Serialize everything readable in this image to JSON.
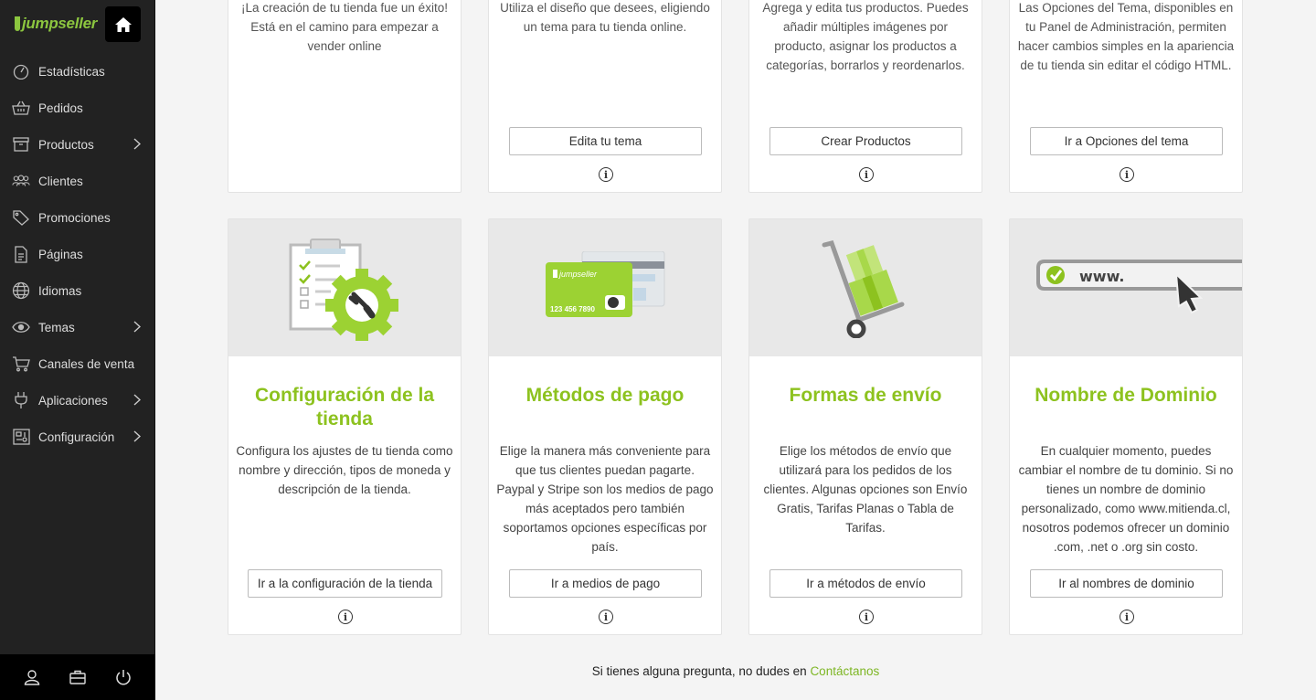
{
  "sidebar": {
    "logo_text": "jumpseller",
    "items": [
      {
        "label": "Estadísticas",
        "icon": "gauge-icon"
      },
      {
        "label": "Pedidos",
        "icon": "basket-icon"
      },
      {
        "label": "Productos",
        "icon": "box-icon",
        "has_submenu": true
      },
      {
        "label": "Clientes",
        "icon": "users-icon"
      },
      {
        "label": "Promociones",
        "icon": "tag-icon"
      },
      {
        "label": "Páginas",
        "icon": "page-icon"
      },
      {
        "label": "Idiomas",
        "icon": "globe-icon"
      },
      {
        "label": "Temas",
        "icon": "eye-icon",
        "has_submenu": true
      },
      {
        "label": "Canales de venta",
        "icon": "cart-icon"
      },
      {
        "label": "Aplicaciones",
        "icon": "plug-icon",
        "has_submenu": true
      },
      {
        "label": "Configuración",
        "icon": "settings-panel-icon",
        "has_submenu": true
      }
    ],
    "bottom_icons": [
      "user-icon",
      "briefcase-icon",
      "power-icon"
    ]
  },
  "top_cards": [
    {
      "desc": "¡La creación de tu tienda fue un éxito! Está en el camino para empezar a vender online"
    },
    {
      "desc": "Utiliza el diseño que desees, eligiendo un tema para tu tienda online.",
      "button": "Edita tu tema"
    },
    {
      "desc": "Agrega y edita tus productos. Puedes añadir múltiples imágenes por producto, asignar los productos a categorías, borrarlos y reordenarlos.",
      "button": "Crear Productos"
    },
    {
      "desc": "Las Opciones del Tema, disponibles en tu Panel de Administración, permiten hacer cambios simples en la apariencia de tu tienda sin editar el código HTML.",
      "button": "Ir a Opciones del tema"
    }
  ],
  "cards": [
    {
      "title": "Configuración de la tienda",
      "desc": "Configura los ajustes de tu tienda como nombre y dirección, tipos de moneda y descripción de la tienda.",
      "button": "Ir a la configuración de la tienda"
    },
    {
      "title": "Métodos de pago",
      "desc": "Elige la manera más conveniente para que tus clientes puedan pagarte. Paypal y Stripe son los medios de pago más aceptados pero también soportamos opciones específicas por país.",
      "button": "Ir a medios de pago",
      "card_brand": "jumpseller",
      "card_number": "123 456 7890"
    },
    {
      "title": "Formas de envío",
      "desc": "Elige los métodos de envío que utilizará para los pedidos de los clientes. Algunas opciones son Envío Gratis, Tarifas Planas o Tabla de Tarifas.",
      "button": "Ir a métodos de envío"
    },
    {
      "title": "Nombre de Dominio",
      "desc": "En cualquier momento, puedes cambiar el nombre de tu dominio. Si no tienes un nombre de dominio personalizado, como www.mitienda.cl, nosotros podemos ofrecer un dominio .com, .net o .org sin costo.",
      "button": "Ir al nombres de dominio",
      "url_text": "www."
    }
  ],
  "info_glyph": "i",
  "footer": {
    "text": "Si tienes alguna pregunta, no dudes en ",
    "link": "Contáctanos"
  },
  "colors": {
    "accent": "#8dc21f",
    "sidebar_bg": "#222222"
  }
}
